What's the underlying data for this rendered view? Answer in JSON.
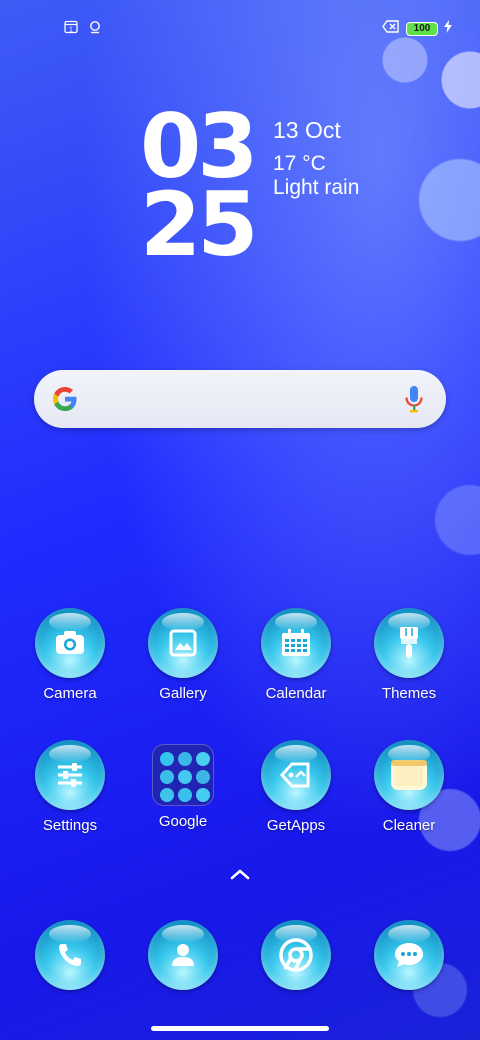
{
  "status_bar": {
    "battery_level": "100",
    "icons": [
      "calendar-icon",
      "location-icon",
      "no-sim-icon",
      "battery-icon",
      "charging-icon"
    ]
  },
  "clock": {
    "hours": "03",
    "minutes": "25"
  },
  "weather": {
    "date": "13 Oct",
    "temperature": "17 °C",
    "condition": "Light rain"
  },
  "search_bar": {
    "icons": [
      "google-logo",
      "mic-icon"
    ]
  },
  "apps_row1": [
    {
      "label": "Camera",
      "icon": "camera-icon"
    },
    {
      "label": "Gallery",
      "icon": "gallery-icon"
    },
    {
      "label": "Calendar",
      "icon": "calendar-icon"
    },
    {
      "label": "Themes",
      "icon": "brush-icon"
    }
  ],
  "apps_row2": [
    {
      "label": "Settings",
      "icon": "sliders-icon"
    },
    {
      "label": "Google",
      "icon": "folder-icon"
    },
    {
      "label": "GetApps",
      "icon": "tag-icon"
    },
    {
      "label": "Cleaner",
      "icon": "cleaner-icon"
    }
  ],
  "dock": [
    {
      "icon": "phone-icon"
    },
    {
      "icon": "contacts-icon"
    },
    {
      "icon": "chrome-icon"
    },
    {
      "icon": "messages-icon"
    }
  ],
  "colors": {
    "bubble": "#38c7ec",
    "background": "#1f2cff",
    "battery": "#5ee04a"
  }
}
